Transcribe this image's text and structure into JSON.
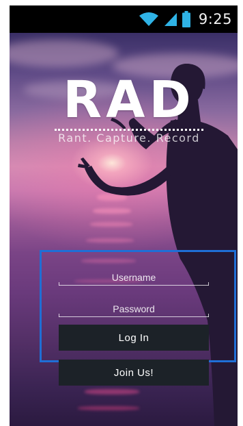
{
  "status_bar": {
    "time": "9:25",
    "icons": [
      "wifi-icon",
      "signal-icon",
      "battery-icon"
    ]
  },
  "logo": {
    "text": "RAD",
    "tagline": "Rant. Capture. Record"
  },
  "login_form": {
    "username_placeholder": "Username",
    "password_placeholder": "Password",
    "login_label": "Log In",
    "join_label": "Join Us!"
  },
  "colors": {
    "status_icons": "#2fb3e6",
    "button_bg": "#1c2228",
    "highlight_box": "#1f6fd6"
  }
}
